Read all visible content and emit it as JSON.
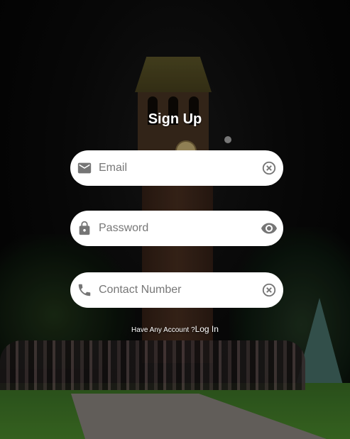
{
  "title": "Sign Up",
  "fields": [
    {
      "placeholder": "Email",
      "value": "",
      "lead_icon": "email-icon",
      "trail_icon": "clear-icon"
    },
    {
      "placeholder": "Password",
      "value": "",
      "lead_icon": "lock-icon",
      "trail_icon": "eye-icon"
    },
    {
      "placeholder": "Contact Number",
      "value": "",
      "lead_icon": "phone-icon",
      "trail_icon": "clear-icon"
    }
  ],
  "footer": {
    "question": "Have Any Account ?",
    "link": "Log In"
  },
  "colors": {
    "field_bg": "#ffffff",
    "icon": "#757575",
    "text": "#ffffff"
  }
}
